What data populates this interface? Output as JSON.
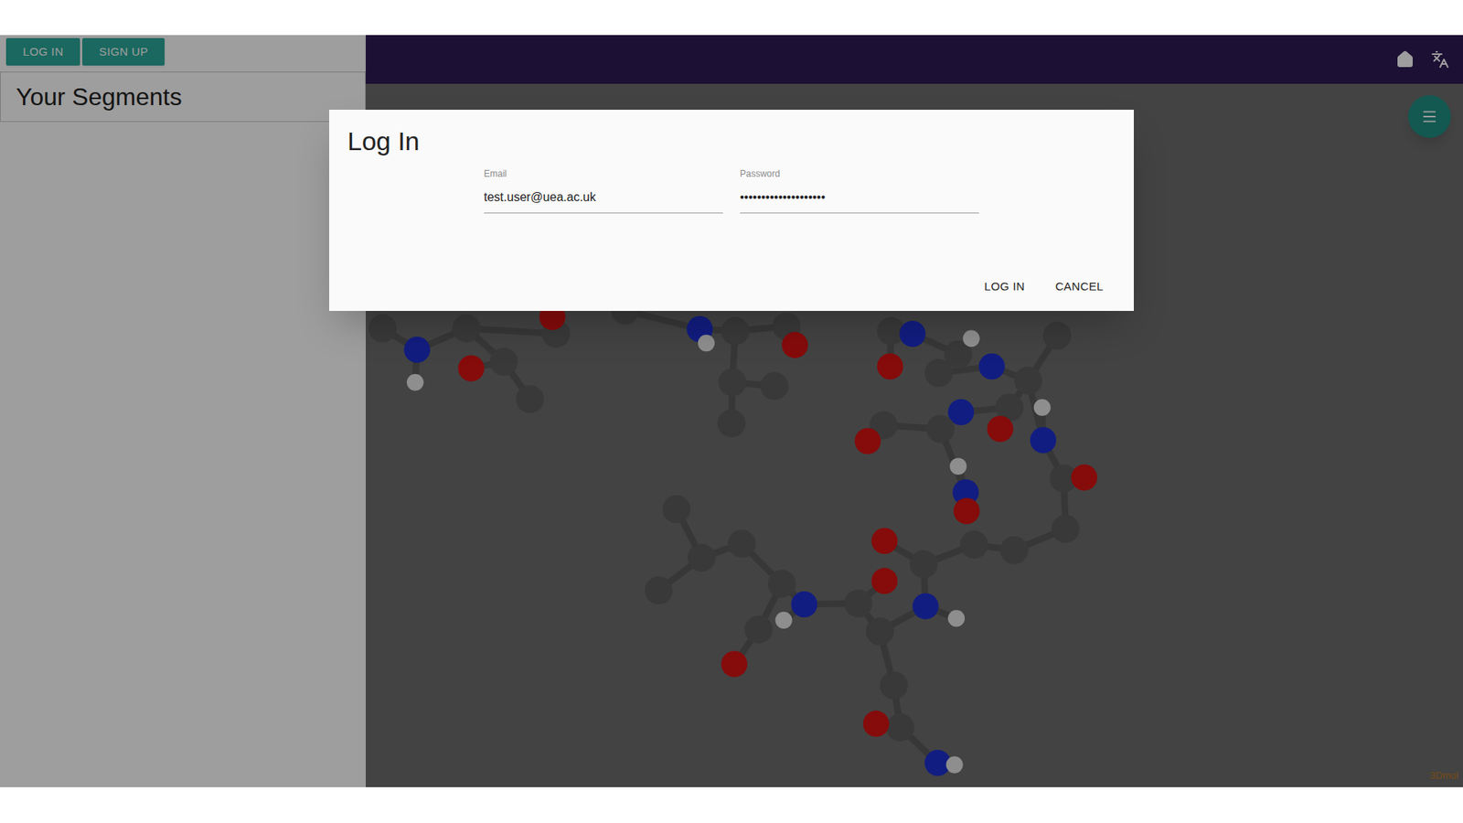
{
  "sidebar": {
    "buttons": [
      "LOG IN",
      "SIGN UP"
    ],
    "title": "Your Segments"
  },
  "viewer": {
    "watermark": "3Dmol"
  },
  "dialog": {
    "title": "Log In",
    "fields": [
      {
        "label": "Email",
        "value": "test.user@uea.ac.uk"
      },
      {
        "label": "Password",
        "value": "••••••••••••••••••••"
      }
    ],
    "buttons": [
      "LOG IN",
      "CANCEL"
    ]
  }
}
